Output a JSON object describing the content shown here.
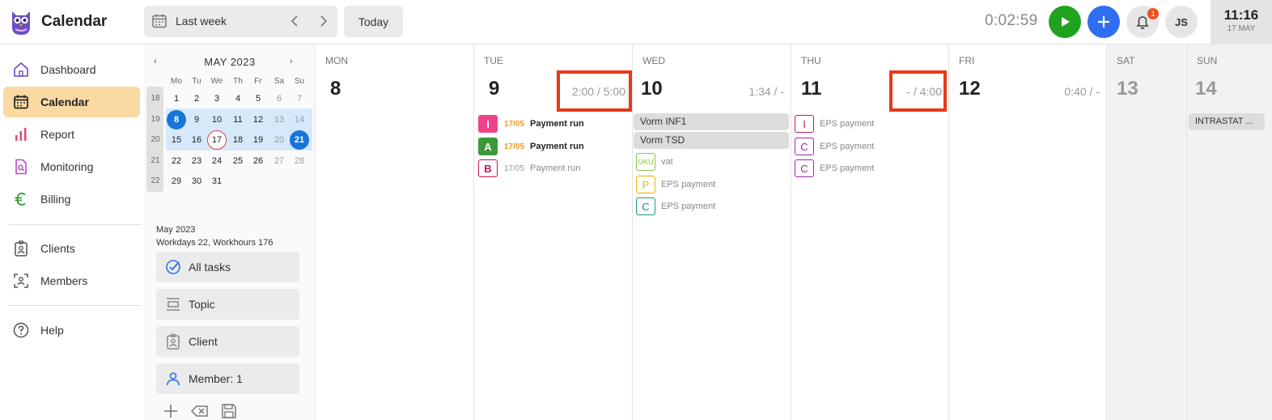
{
  "header": {
    "app_title": "Calendar",
    "range_label": "Last week",
    "today_label": "Today",
    "timer": "0:02:59",
    "notification_count": "1",
    "user_initials": "JS",
    "clock_time": "11:16",
    "clock_date": "17 MAY",
    "colors": {
      "play": "#1fa31f",
      "add": "#2f6ef0",
      "badge": "#f04e1f"
    }
  },
  "sidebar": {
    "items": [
      {
        "label": "Dashboard",
        "icon": "home-icon"
      },
      {
        "label": "Calendar",
        "icon": "calendar-icon",
        "active": true
      },
      {
        "label": "Report",
        "icon": "bar-chart-icon"
      },
      {
        "label": "Monitoring",
        "icon": "document-search-icon"
      },
      {
        "label": "Billing",
        "icon": "euro-icon"
      },
      {
        "label": "Clients",
        "icon": "contact-card-icon"
      },
      {
        "label": "Members",
        "icon": "members-icon"
      },
      {
        "label": "Help",
        "icon": "help-icon"
      }
    ]
  },
  "mini_calendar": {
    "title": "MAY 2023",
    "prev": "‹",
    "next": "›",
    "weekdays": [
      "Mo",
      "Tu",
      "We",
      "Th",
      "Fr",
      "Sa",
      "Su"
    ],
    "weeks": [
      {
        "wk": "18",
        "days": [
          "1",
          "2",
          "3",
          "4",
          "5",
          "6",
          "7"
        ]
      },
      {
        "wk": "19",
        "days": [
          "8",
          "9",
          "10",
          "11",
          "12",
          "13",
          "14"
        ]
      },
      {
        "wk": "20",
        "days": [
          "15",
          "16",
          "17",
          "18",
          "19",
          "20",
          "21"
        ]
      },
      {
        "wk": "21",
        "days": [
          "22",
          "23",
          "24",
          "25",
          "26",
          "27",
          "28"
        ]
      },
      {
        "wk": "22",
        "days": [
          "29",
          "30",
          "31"
        ]
      }
    ],
    "summary_month": "May 2023",
    "summary_stats": "Workdays 22, Workhours 176"
  },
  "filters": [
    {
      "label": "All tasks",
      "icon": "check-circle-icon"
    },
    {
      "label": "Topic",
      "icon": "topic-icon"
    },
    {
      "label": "Client",
      "icon": "client-card-icon"
    },
    {
      "label": "Member: 1",
      "icon": "person-icon"
    }
  ],
  "days": [
    {
      "dow": "MON",
      "num": "8",
      "hours": ""
    },
    {
      "dow": "TUE",
      "num": "9",
      "hours": "2:00 / 5:00"
    },
    {
      "dow": "WED",
      "num": "10",
      "hours": "1:34 / -"
    },
    {
      "dow": "THU",
      "num": "11",
      "hours": "- / 4:00"
    },
    {
      "dow": "FRI",
      "num": "12",
      "hours": "0:40 / -"
    },
    {
      "dow": "SAT",
      "num": "13",
      "hours": ""
    },
    {
      "dow": "SUN",
      "num": "14",
      "hours": ""
    }
  ],
  "tasks": {
    "tue": [
      {
        "badge": "I",
        "date": "17/05",
        "title": "Payment run",
        "badge_color": "#f0428a"
      },
      {
        "badge": "A",
        "date": "17/05",
        "title": "Payment run",
        "badge_color": "#3a9a3a"
      },
      {
        "badge": "B",
        "date": "17/05",
        "title": "Payment run",
        "badge_color": "#c2185b"
      }
    ],
    "wed_pills": [
      "Vorm INF1",
      "Vorm TSD"
    ],
    "wed": [
      {
        "badge": "UKU",
        "title": "vat",
        "badge_color": "#8bc34a"
      },
      {
        "badge": "P",
        "title": "EPS payment",
        "badge_color": "#f2b300"
      },
      {
        "badge": "C",
        "title": "EPS payment",
        "badge_color": "#1a9a80"
      }
    ],
    "thu": [
      {
        "badge": "I",
        "title": "EPS payment",
        "badge_color": "#c2185b"
      },
      {
        "badge": "C",
        "title": "EPS payment",
        "badge_color": "#9c27b0"
      },
      {
        "badge": "C",
        "title": "EPS payment",
        "badge_color": "#9c27b0"
      }
    ],
    "sun_pills": [
      "INTRASTAT ..."
    ]
  }
}
